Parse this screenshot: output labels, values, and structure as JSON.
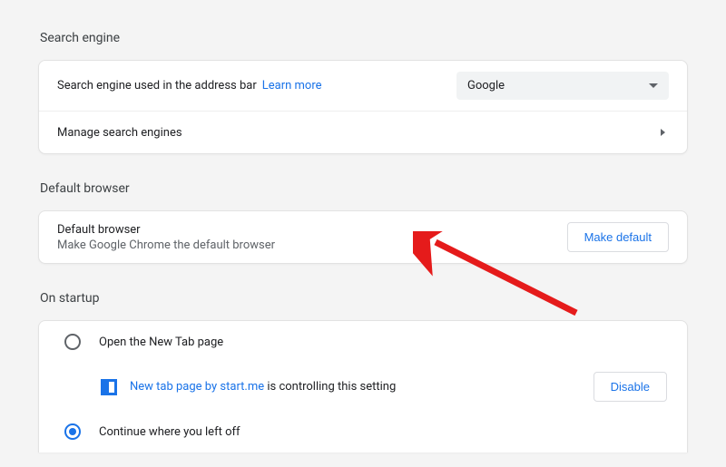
{
  "sections": {
    "search_engine": {
      "title": "Search engine",
      "row1_label": "Search engine used in the address bar",
      "learn_more": "Learn more",
      "dropdown_value": "Google",
      "manage": "Manage search engines"
    },
    "default_browser": {
      "title": "Default browser",
      "row1_label": "Default browser",
      "row1_sub": "Make Google Chrome the default browser",
      "make_default": "Make default"
    },
    "on_startup": {
      "title": "On startup",
      "opt_new_tab": "Open the New Tab page",
      "extension_name": "New tab page by start.me",
      "extension_suffix": " is controlling this setting",
      "disable": "Disable",
      "opt_continue": "Continue where you left off"
    }
  }
}
